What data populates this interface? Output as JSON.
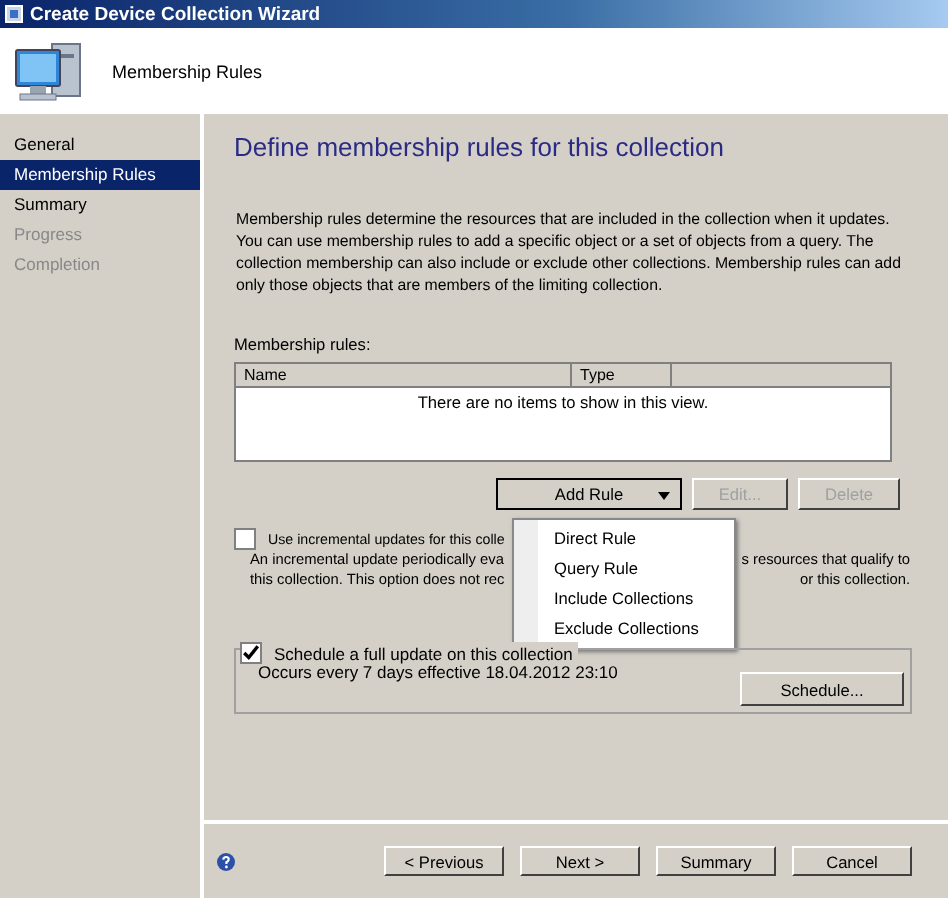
{
  "window": {
    "title": "Create Device Collection Wizard"
  },
  "header": {
    "title": "Membership Rules"
  },
  "steps": [
    {
      "label": "General",
      "selected": false,
      "disabled": false
    },
    {
      "label": "Membership Rules",
      "selected": true,
      "disabled": false
    },
    {
      "label": "Summary",
      "selected": false,
      "disabled": false
    },
    {
      "label": "Progress",
      "selected": false,
      "disabled": true
    },
    {
      "label": "Completion",
      "selected": false,
      "disabled": true
    }
  ],
  "heading": "Define membership rules for this collection",
  "intro": "Membership rules determine the resources that are included in the collection when it updates. You can use membership rules to add a specific object or a set of objects from a query. The collection membership can also include or exclude other collections. Membership rules can add only those objects that are members of the limiting collection.",
  "rules": {
    "label": "Membership rules:",
    "columns": [
      "Name",
      "Type"
    ],
    "empty_text": "There are no items to show in this view."
  },
  "rule_buttons": [
    {
      "label": "Add Rule",
      "kind": "dropdown",
      "disabled": false
    },
    {
      "label": "Edit...",
      "kind": "plain",
      "disabled": true
    },
    {
      "label": "Delete",
      "kind": "plain",
      "disabled": true
    }
  ],
  "add_rule_menu": [
    "Direct Rule",
    "Query Rule",
    "Include Collections",
    "Exclude Collections"
  ],
  "incremental": {
    "label": "Use incremental updates for this colle",
    "checked": false,
    "lines": [
      [
        "An incremental update periodically eva",
        "s resources that qualify to"
      ],
      [
        "this collection. This option does not rec",
        "or this collection."
      ]
    ]
  },
  "full_update": {
    "label": "Schedule a full update on this collection",
    "checked": true,
    "detail": "Occurs every 7 days effective 18.04.2012 23:10",
    "button": "Schedule..."
  },
  "footer_buttons": [
    "< Previous",
    "Next >",
    "Summary",
    "Cancel"
  ]
}
